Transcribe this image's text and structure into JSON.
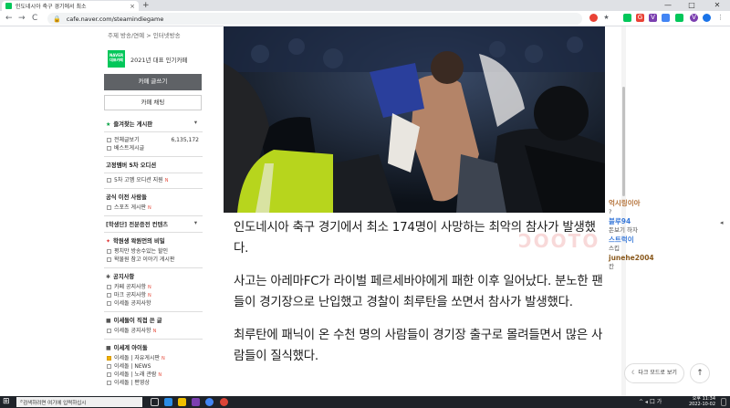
{
  "browser": {
    "tab_title": "인도네시아 축구 경기에서 최소",
    "url": "cafe.naver.com/steamindiegame",
    "new_tab": "+",
    "tab_close": "×",
    "lock": "🔒",
    "back": "←",
    "forward": "→",
    "reload": "C",
    "minimize": "—",
    "maximize": "□",
    "close": "✕",
    "ext_labels": [
      "G",
      "V",
      "V"
    ]
  },
  "sidebar": {
    "topnav": "주제 방송/연예 > 인터넷방송",
    "naver_badge_line1": "NAVER",
    "naver_badge_line2": "대표카페",
    "award_text": "2021년 대표 인기카페",
    "write_button": "카페 글쓰기",
    "chat_button": "카페 채팅",
    "favorites_title": "즐겨찾는 게시판",
    "all_posts": "전체글보기",
    "all_posts_count": "6,135,172",
    "best_posts": "베스트게시글",
    "subscribe_title": "고정멤버 5차 오디션",
    "subscribe_item": "5차 고멤 오디션 지원",
    "news_title": "공식 이전 사람들",
    "sports_board": "스포츠 게시판",
    "club_title": "[학생단] 전분증전 컨텐츠",
    "woodin_title": "학원생 왁원먼의 비밀",
    "woodin_item1": "평치만 방송수있는 할인",
    "woodin_item2": "왁물원 참고 이야기 게시판",
    "notice_title": "공지사항",
    "notice_item1": "카페 공지사항",
    "notice_item2": "마크 공지사항",
    "notice_item3": "이세돌 공지사항",
    "isedol_title": "이세돌이 직접 쓴 글",
    "isedol_item": "이세돌 공지사항",
    "idol_title": "이세계 아이돌",
    "idol_item1": "이세돌 | 자유게시판",
    "idol_item2": "이세돌 | NEWS",
    "idol_item3": "이세돌 | 노래 관람",
    "idol_item4": "이세돌 | 편영상",
    "new_mark": "N",
    "caret": "▾"
  },
  "article": {
    "paragraphs": [
      "인도네시아 축구 경기에서 최소 174명이 사망하는 최악의 참사가 발생했다.",
      "사고는 아레마FC가 라이벌 페르세바야에게 패한 이후 일어났다. 분노한 팬들이 경기장으로 난입했고 경찰이 최루탄을 쏘면서 참사가 발생했다.",
      "최루탄에 패닉이 온 수천 명의 사람들이 경기장 출구로 몰려들면서 많은 사람들이 질식했다."
    ],
    "watermark": "ƆOOTO"
  },
  "chat": {
    "messages": [
      {
        "nick": "억시링이아",
        "text": "?",
        "color": "#b5733a"
      },
      {
        "nick": "블루94",
        "text": "돈보기 하자",
        "color": "#3a7ad9"
      },
      {
        "nick": "스트럭이",
        "text": "스킵",
        "color": "#3a7ad9"
      },
      {
        "nick": "junehe2004",
        "text": "칸",
        "color": "#8a5a1e"
      }
    ],
    "dark_mode": "다크 모드로 보기",
    "top_button": "↑",
    "side_arrow": "◂"
  },
  "taskbar": {
    "start": "⊞",
    "search_placeholder": "검색하려면 여기에 입력하십시",
    "clock_time": "오후 11:34",
    "clock_date": "2022-10-02",
    "tray": "^ ◂ 口 가"
  },
  "colors": {
    "accent_green": "#03c75a",
    "new_badge": "#e64b3b"
  }
}
